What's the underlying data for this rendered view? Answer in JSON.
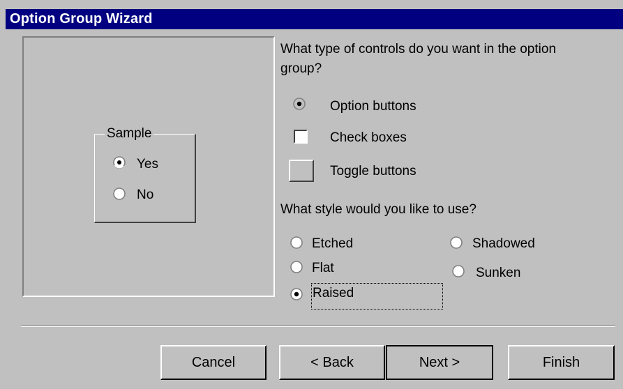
{
  "window": {
    "title": "Option Group Wizard"
  },
  "sample": {
    "group_label": "Sample",
    "options": [
      {
        "label": "Yes",
        "selected": true
      },
      {
        "label": "No",
        "selected": false
      }
    ]
  },
  "controls_question": {
    "line1": "What type of controls do you want in the option",
    "line2": "group?"
  },
  "control_types": [
    {
      "label": "Option buttons",
      "selected": true,
      "kind": "radio-icon"
    },
    {
      "label": "Check boxes",
      "selected": false,
      "kind": "checkbox-icon"
    },
    {
      "label": "Toggle buttons",
      "selected": false,
      "kind": "toggle-icon"
    }
  ],
  "style_question": "What style would you like to use?",
  "styles": {
    "etched": {
      "label": "Etched",
      "selected": false
    },
    "flat": {
      "label": "Flat",
      "selected": false
    },
    "raised": {
      "label": "Raised",
      "selected": true
    },
    "shadowed": {
      "label": "Shadowed",
      "selected": false
    },
    "sunken": {
      "label": "Sunken",
      "selected": false
    }
  },
  "buttons": {
    "cancel": "Cancel",
    "back": "< Back",
    "next": "Next >",
    "finish": "Finish"
  },
  "colors": {
    "titlebar": "#000080",
    "face": "#c0c0c0"
  }
}
